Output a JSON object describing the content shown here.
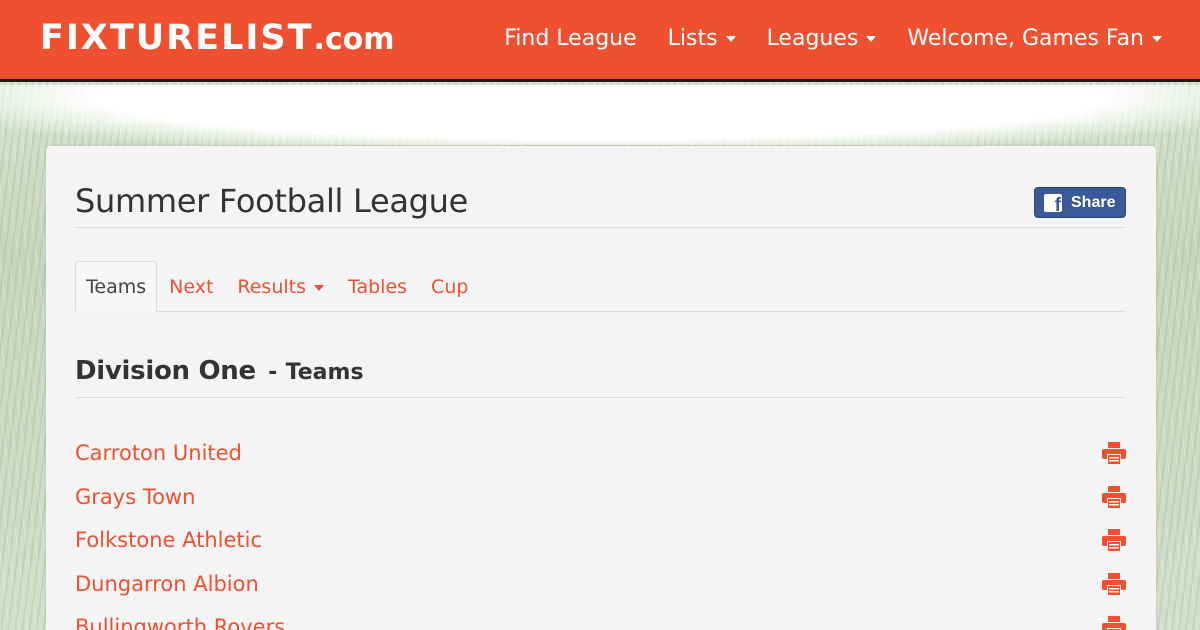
{
  "navbar": {
    "logo_main": "FIXTURELIST",
    "logo_tld": ".com",
    "links": [
      {
        "label": "Find League",
        "dropdown": false
      },
      {
        "label": "Lists",
        "dropdown": true
      },
      {
        "label": "Leagues",
        "dropdown": true
      },
      {
        "label": "Welcome, Games Fan",
        "dropdown": true
      }
    ],
    "accent_color": "#ee5030"
  },
  "page": {
    "title": "Summer Football League",
    "share_label": "Share",
    "share_color": "#3b5998"
  },
  "tabs": [
    {
      "label": "Teams",
      "active": true,
      "dropdown": false
    },
    {
      "label": "Next",
      "active": false,
      "dropdown": false
    },
    {
      "label": "Results",
      "active": false,
      "dropdown": true
    },
    {
      "label": "Tables",
      "active": false,
      "dropdown": false
    },
    {
      "label": "Cup",
      "active": false,
      "dropdown": false
    }
  ],
  "section": {
    "division": "Division One",
    "separator": "-",
    "subtitle": "Teams"
  },
  "teams": [
    {
      "name": "Carroton United",
      "icon": "print-icon"
    },
    {
      "name": "Grays Town",
      "icon": "print-icon"
    },
    {
      "name": "Folkstone Athletic",
      "icon": "print-icon"
    },
    {
      "name": "Dungarron Albion",
      "icon": "print-icon"
    },
    {
      "name": "Bullingworth Rovers",
      "icon": "print-icon"
    }
  ]
}
